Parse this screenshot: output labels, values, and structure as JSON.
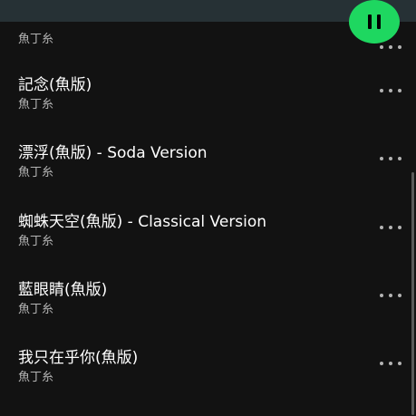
{
  "colors": {
    "background": "#121212",
    "header": "#263135",
    "accent": "#1ed760",
    "secondary_text": "#b3b3b3"
  },
  "play_button": {
    "icon": "pause-icon"
  },
  "top_partial_row": {
    "artist": "魚丁糸"
  },
  "tracks": [
    {
      "title": "記念(魚版)",
      "artist": "魚丁糸"
    },
    {
      "title": "漂浮(魚版) - Soda Version",
      "artist": "魚丁糸"
    },
    {
      "title": "蜘蛛天空(魚版) - Classical Version",
      "artist": "魚丁糸"
    },
    {
      "title": "藍眼睛(魚版)",
      "artist": "魚丁糸"
    },
    {
      "title": "我只在乎你(魚版)",
      "artist": "魚丁糸"
    }
  ],
  "more_icon": "more-horizontal-icon"
}
